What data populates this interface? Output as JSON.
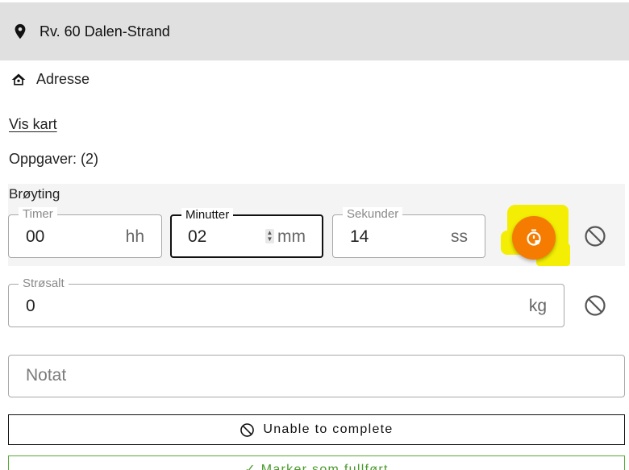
{
  "header": {
    "title": "Rv. 60 Dalen-Strand"
  },
  "address": {
    "label": "Adresse"
  },
  "map_link": {
    "label": "Vis kart"
  },
  "tasks": {
    "summary": "Oppgaver: (2)"
  },
  "task_brøyting": {
    "name": "Brøyting",
    "hours": {
      "label": "Timer",
      "value": "00",
      "unit": "hh"
    },
    "minutes": {
      "label": "Minutter",
      "value": "02",
      "unit": "mm"
    },
    "seconds": {
      "label": "Sekunder",
      "value": "14",
      "unit": "ss"
    }
  },
  "task_strøsalt": {
    "label": "Strøsalt",
    "value": "0",
    "unit": "kg"
  },
  "note": {
    "placeholder": "Notat"
  },
  "actions": {
    "unable_label": "Unable to complete",
    "done_label": "✓ Marker som fullført"
  },
  "colors": {
    "header_bg": "#e0e0e0",
    "timer_button": "#f57c00",
    "highlight": "#f4ee05",
    "done_green": "#4a9a2c"
  },
  "icons": {
    "header": "location-pin-icon",
    "address": "home-icon",
    "timer": "stopwatch-icon",
    "block": "block-icon"
  }
}
